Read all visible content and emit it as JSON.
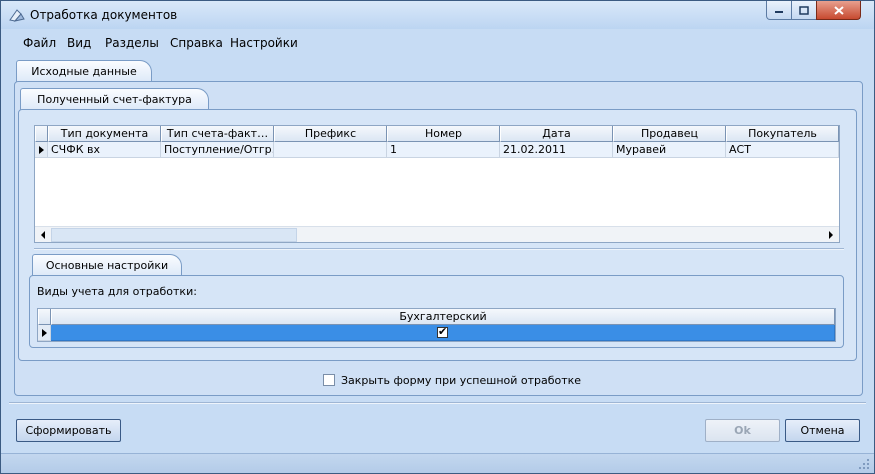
{
  "window": {
    "title": "Отработка документов",
    "minimize_glyph": "−",
    "maximize_glyph": "□",
    "close_glyph": "✕"
  },
  "menu": {
    "items": [
      "Файл",
      "Вид",
      "Разделы",
      "Справка",
      "Настройки"
    ]
  },
  "tabs": {
    "outer": "Исходные данные",
    "inner": "Полученный счет-фактура",
    "settings": "Основные настройки"
  },
  "doc_grid": {
    "columns": [
      "Тип документа",
      "Тип счета-факт…",
      "Префикс",
      "Номер",
      "Дата",
      "Продавец",
      "Покупатель"
    ],
    "rows": [
      [
        "СЧФК вх",
        "Поступление/Отгр…",
        "",
        "1",
        "21.02.2011",
        "Муравей",
        "АСТ"
      ]
    ]
  },
  "settings": {
    "label": "Виды учета для отработки:",
    "column": "Бухгалтерский",
    "checked": true,
    "check_glyph": "✔"
  },
  "close_on_success": {
    "label": "Закрыть форму при успешной отработке",
    "checked": false
  },
  "buttons": {
    "generate": "Сформировать",
    "ok": "Ok",
    "cancel": "Отмена"
  },
  "colors": {
    "selected_row": "#3a8ee6",
    "window_bg": "#c7dcf4"
  }
}
